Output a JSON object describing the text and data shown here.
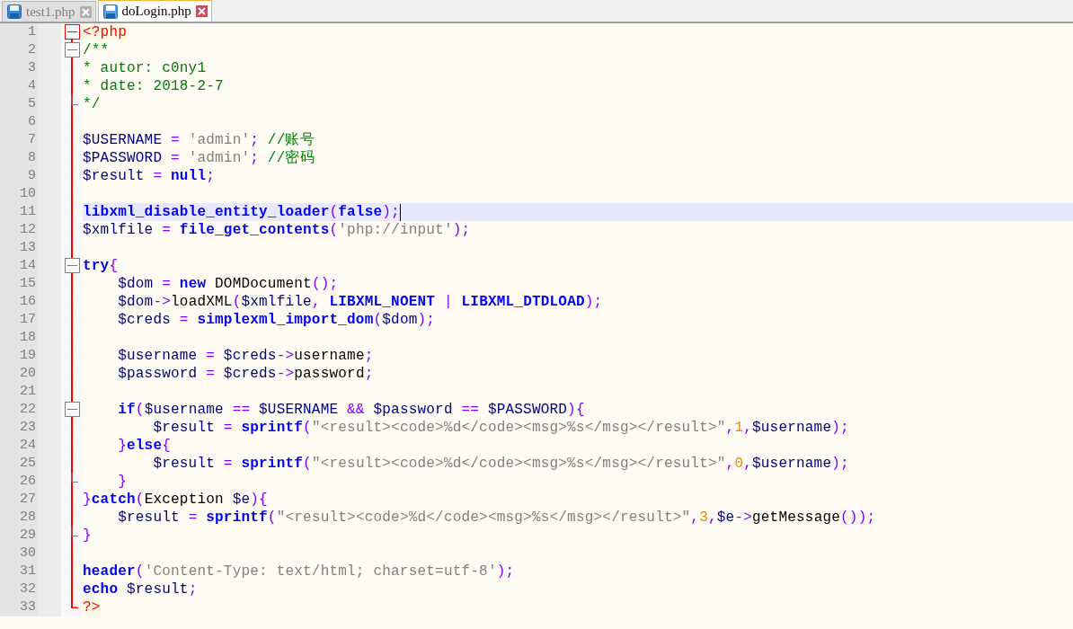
{
  "tabs": [
    {
      "label": "test1.php",
      "selected": false
    },
    {
      "label": "doLogin.php",
      "selected": true
    }
  ],
  "editor": {
    "lines": [
      {
        "number": "1",
        "kind": "fold-start",
        "active": true,
        "tokens": [
          {
            "kind": "tag",
            "text": "<?php"
          }
        ]
      },
      {
        "number": "2",
        "kind": "fold-start",
        "tokens": [
          {
            "kind": "comment",
            "text": "/**"
          }
        ]
      },
      {
        "number": "3",
        "kind": "body",
        "tokens": [
          {
            "kind": "comment",
            "text": "* autor: c0ny1"
          }
        ]
      },
      {
        "number": "4",
        "kind": "body",
        "tokens": [
          {
            "kind": "comment",
            "text": "* date: 2018-2-7"
          }
        ]
      },
      {
        "number": "5",
        "kind": "fold-end",
        "tokens": [
          {
            "kind": "comment",
            "text": "*/"
          }
        ]
      },
      {
        "number": "6",
        "kind": "body"
      },
      {
        "number": "7",
        "kind": "body",
        "tokens": [
          {
            "kind": "var",
            "text": "$USERNAME"
          },
          {
            "kind": "op",
            "text": " ="
          },
          {
            "kind": "str",
            "text": " 'admin'"
          },
          {
            "kind": "op",
            "text": ";"
          },
          {
            "kind": "comment",
            "text": " //账号"
          }
        ]
      },
      {
        "number": "8",
        "kind": "body",
        "tokens": [
          {
            "kind": "var",
            "text": "$PASSWORD"
          },
          {
            "kind": "op",
            "text": " ="
          },
          {
            "kind": "str",
            "text": " 'admin'"
          },
          {
            "kind": "op",
            "text": ";"
          },
          {
            "kind": "comment",
            "text": " //密码"
          }
        ]
      },
      {
        "number": "9",
        "kind": "body",
        "tokens": [
          {
            "kind": "var",
            "text": "$result"
          },
          {
            "kind": "op",
            "text": " ="
          },
          {
            "kind": "kw",
            "text": " null"
          },
          {
            "kind": "op",
            "text": ";"
          }
        ]
      },
      {
        "number": "10",
        "kind": "body"
      },
      {
        "number": "11",
        "kind": "body",
        "current": true,
        "tokens": [
          {
            "kind": "kw",
            "text": "libxml_disable_entity_loader"
          },
          {
            "kind": "op",
            "text": "("
          },
          {
            "kind": "kw",
            "text": "false"
          },
          {
            "kind": "op",
            "text": ");"
          }
        ]
      },
      {
        "number": "12",
        "kind": "body",
        "tokens": [
          {
            "kind": "var",
            "text": "$xmlfile"
          },
          {
            "kind": "op",
            "text": " ="
          },
          {
            "kind": "kw",
            "text": " file_get_contents"
          },
          {
            "kind": "op",
            "text": "("
          },
          {
            "kind": "str",
            "text": "'php://input'"
          },
          {
            "kind": "op",
            "text": ");"
          }
        ]
      },
      {
        "number": "13",
        "kind": "body"
      },
      {
        "number": "14",
        "kind": "fold-start",
        "tokens": [
          {
            "kind": "kw",
            "text": "try"
          },
          {
            "kind": "op",
            "text": "{"
          }
        ]
      },
      {
        "number": "15",
        "kind": "body",
        "tokens": [
          {
            "kind": "var",
            "text": "    $dom"
          },
          {
            "kind": "op",
            "text": " ="
          },
          {
            "kind": "kw",
            "text": " new"
          },
          {
            "kind": "plain",
            "text": " DOMDocument"
          },
          {
            "kind": "op",
            "text": "();"
          }
        ]
      },
      {
        "number": "16",
        "kind": "body",
        "tokens": [
          {
            "kind": "var",
            "text": "    $dom"
          },
          {
            "kind": "op",
            "text": "->"
          },
          {
            "kind": "plain",
            "text": "loadXML"
          },
          {
            "kind": "op",
            "text": "("
          },
          {
            "kind": "var",
            "text": "$xmlfile"
          },
          {
            "kind": "op",
            "text": ","
          },
          {
            "kind": "kw",
            "text": " LIBXML_NOENT"
          },
          {
            "kind": "op",
            "text": " |"
          },
          {
            "kind": "kw",
            "text": " LIBXML_DTDLOAD"
          },
          {
            "kind": "op",
            "text": ");"
          }
        ]
      },
      {
        "number": "17",
        "kind": "body",
        "tokens": [
          {
            "kind": "var",
            "text": "    $creds"
          },
          {
            "kind": "op",
            "text": " ="
          },
          {
            "kind": "kw",
            "text": " simplexml_import_dom"
          },
          {
            "kind": "op",
            "text": "("
          },
          {
            "kind": "var",
            "text": "$dom"
          },
          {
            "kind": "op",
            "text": ");"
          }
        ]
      },
      {
        "number": "18",
        "kind": "body"
      },
      {
        "number": "19",
        "kind": "body",
        "tokens": [
          {
            "kind": "var",
            "text": "    $username"
          },
          {
            "kind": "op",
            "text": " ="
          },
          {
            "kind": "var",
            "text": " $creds"
          },
          {
            "kind": "op",
            "text": "->"
          },
          {
            "kind": "plain",
            "text": "username"
          },
          {
            "kind": "op",
            "text": ";"
          }
        ]
      },
      {
        "number": "20",
        "kind": "body",
        "tokens": [
          {
            "kind": "var",
            "text": "    $password"
          },
          {
            "kind": "op",
            "text": " ="
          },
          {
            "kind": "var",
            "text": " $creds"
          },
          {
            "kind": "op",
            "text": "->"
          },
          {
            "kind": "plain",
            "text": "password"
          },
          {
            "kind": "op",
            "text": ";"
          }
        ]
      },
      {
        "number": "21",
        "kind": "body"
      },
      {
        "number": "22",
        "kind": "fold-start",
        "tokens": [
          {
            "kind": "kw",
            "text": "    if"
          },
          {
            "kind": "op",
            "text": "("
          },
          {
            "kind": "var",
            "text": "$username"
          },
          {
            "kind": "op",
            "text": " =="
          },
          {
            "kind": "var",
            "text": " $USERNAME"
          },
          {
            "kind": "op",
            "text": " &&"
          },
          {
            "kind": "var",
            "text": " $password"
          },
          {
            "kind": "op",
            "text": " =="
          },
          {
            "kind": "var",
            "text": " $PASSWORD"
          },
          {
            "kind": "op",
            "text": "){"
          }
        ]
      },
      {
        "number": "23",
        "kind": "body",
        "tokens": [
          {
            "kind": "var",
            "text": "        $result"
          },
          {
            "kind": "op",
            "text": " ="
          },
          {
            "kind": "kw",
            "text": " sprintf"
          },
          {
            "kind": "op",
            "text": "("
          },
          {
            "kind": "str",
            "text": "\"<result><code>%d</code><msg>%s</msg></result>\""
          },
          {
            "kind": "op",
            "text": ","
          },
          {
            "kind": "num",
            "text": "1"
          },
          {
            "kind": "op",
            "text": ","
          },
          {
            "kind": "var",
            "text": "$username"
          },
          {
            "kind": "op",
            "text": ");"
          }
        ]
      },
      {
        "number": "24",
        "kind": "body",
        "tokens": [
          {
            "kind": "op",
            "text": "    }"
          },
          {
            "kind": "kw",
            "text": "else"
          },
          {
            "kind": "op",
            "text": "{"
          }
        ]
      },
      {
        "number": "25",
        "kind": "body",
        "tokens": [
          {
            "kind": "var",
            "text": "        $result"
          },
          {
            "kind": "op",
            "text": " ="
          },
          {
            "kind": "kw",
            "text": " sprintf"
          },
          {
            "kind": "op",
            "text": "("
          },
          {
            "kind": "str",
            "text": "\"<result><code>%d</code><msg>%s</msg></result>\""
          },
          {
            "kind": "op",
            "text": ","
          },
          {
            "kind": "num",
            "text": "0"
          },
          {
            "kind": "op",
            "text": ","
          },
          {
            "kind": "var",
            "text": "$username"
          },
          {
            "kind": "op",
            "text": ");"
          }
        ]
      },
      {
        "number": "26",
        "kind": "fold-end",
        "tokens": [
          {
            "kind": "op",
            "text": "    }"
          }
        ]
      },
      {
        "number": "27",
        "kind": "body",
        "tokens": [
          {
            "kind": "op",
            "text": "}"
          },
          {
            "kind": "kw",
            "text": "catch"
          },
          {
            "kind": "op",
            "text": "("
          },
          {
            "kind": "plain",
            "text": "Exception"
          },
          {
            "kind": "var",
            "text": " $e"
          },
          {
            "kind": "op",
            "text": "){"
          }
        ]
      },
      {
        "number": "28",
        "kind": "body",
        "tokens": [
          {
            "kind": "var",
            "text": "    $result"
          },
          {
            "kind": "op",
            "text": " ="
          },
          {
            "kind": "kw",
            "text": " sprintf"
          },
          {
            "kind": "op",
            "text": "("
          },
          {
            "kind": "str",
            "text": "\"<result><code>%d</code><msg>%s</msg></result>\""
          },
          {
            "kind": "op",
            "text": ","
          },
          {
            "kind": "num",
            "text": "3"
          },
          {
            "kind": "op",
            "text": ","
          },
          {
            "kind": "var",
            "text": "$e"
          },
          {
            "kind": "op",
            "text": "->"
          },
          {
            "kind": "plain",
            "text": "getMessage"
          },
          {
            "kind": "op",
            "text": "());"
          }
        ]
      },
      {
        "number": "29",
        "kind": "fold-end",
        "tokens": [
          {
            "kind": "op",
            "text": "}"
          }
        ]
      },
      {
        "number": "30",
        "kind": "body"
      },
      {
        "number": "31",
        "kind": "body",
        "tokens": [
          {
            "kind": "kw",
            "text": "header"
          },
          {
            "kind": "op",
            "text": "("
          },
          {
            "kind": "str",
            "text": "'Content-Type: text/html; charset=utf-8'"
          },
          {
            "kind": "op",
            "text": ");"
          }
        ]
      },
      {
        "number": "32",
        "kind": "body",
        "tokens": [
          {
            "kind": "kw",
            "text": "echo"
          },
          {
            "kind": "var",
            "text": " $result"
          },
          {
            "kind": "op",
            "text": ";"
          }
        ]
      },
      {
        "number": "33",
        "kind": "fold-end",
        "active": true,
        "tokens": [
          {
            "kind": "tag",
            "text": "?>"
          }
        ]
      }
    ]
  }
}
